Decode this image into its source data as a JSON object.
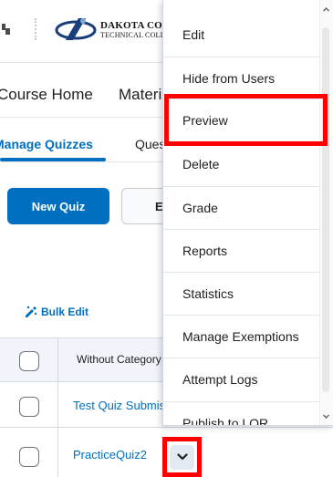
{
  "header": {
    "logo_line1": "DAKOTA COLLEGE",
    "logo_line2": "TECHNICAL COLLEGE"
  },
  "navbar": {
    "items": [
      {
        "label": "Course Home"
      },
      {
        "label": "Materials"
      }
    ]
  },
  "tabs": [
    {
      "label": "Manage Quizzes",
      "active": true
    },
    {
      "label": "Question Library",
      "active": false
    }
  ],
  "toolbar": {
    "new_quiz_label": "New Quiz",
    "edit_label": "Edit"
  },
  "bulk_edit_label": "Bulk Edit",
  "table": {
    "header": "Without Category",
    "rows": [
      {
        "name": "Test Quiz Submission"
      },
      {
        "name": "PracticeQuiz2"
      }
    ]
  },
  "context_menu": {
    "items": [
      {
        "label": "Edit"
      },
      {
        "label": "Hide from Users"
      },
      {
        "label": "Preview",
        "highlighted": true
      },
      {
        "label": "Delete"
      },
      {
        "label": "Grade"
      },
      {
        "label": "Reports"
      },
      {
        "label": "Statistics"
      },
      {
        "label": "Manage Exemptions"
      },
      {
        "label": "Attempt Logs"
      },
      {
        "label": "Publish to LOR"
      }
    ]
  },
  "colors": {
    "accent": "#006fbf",
    "highlight": "#ff0000"
  }
}
